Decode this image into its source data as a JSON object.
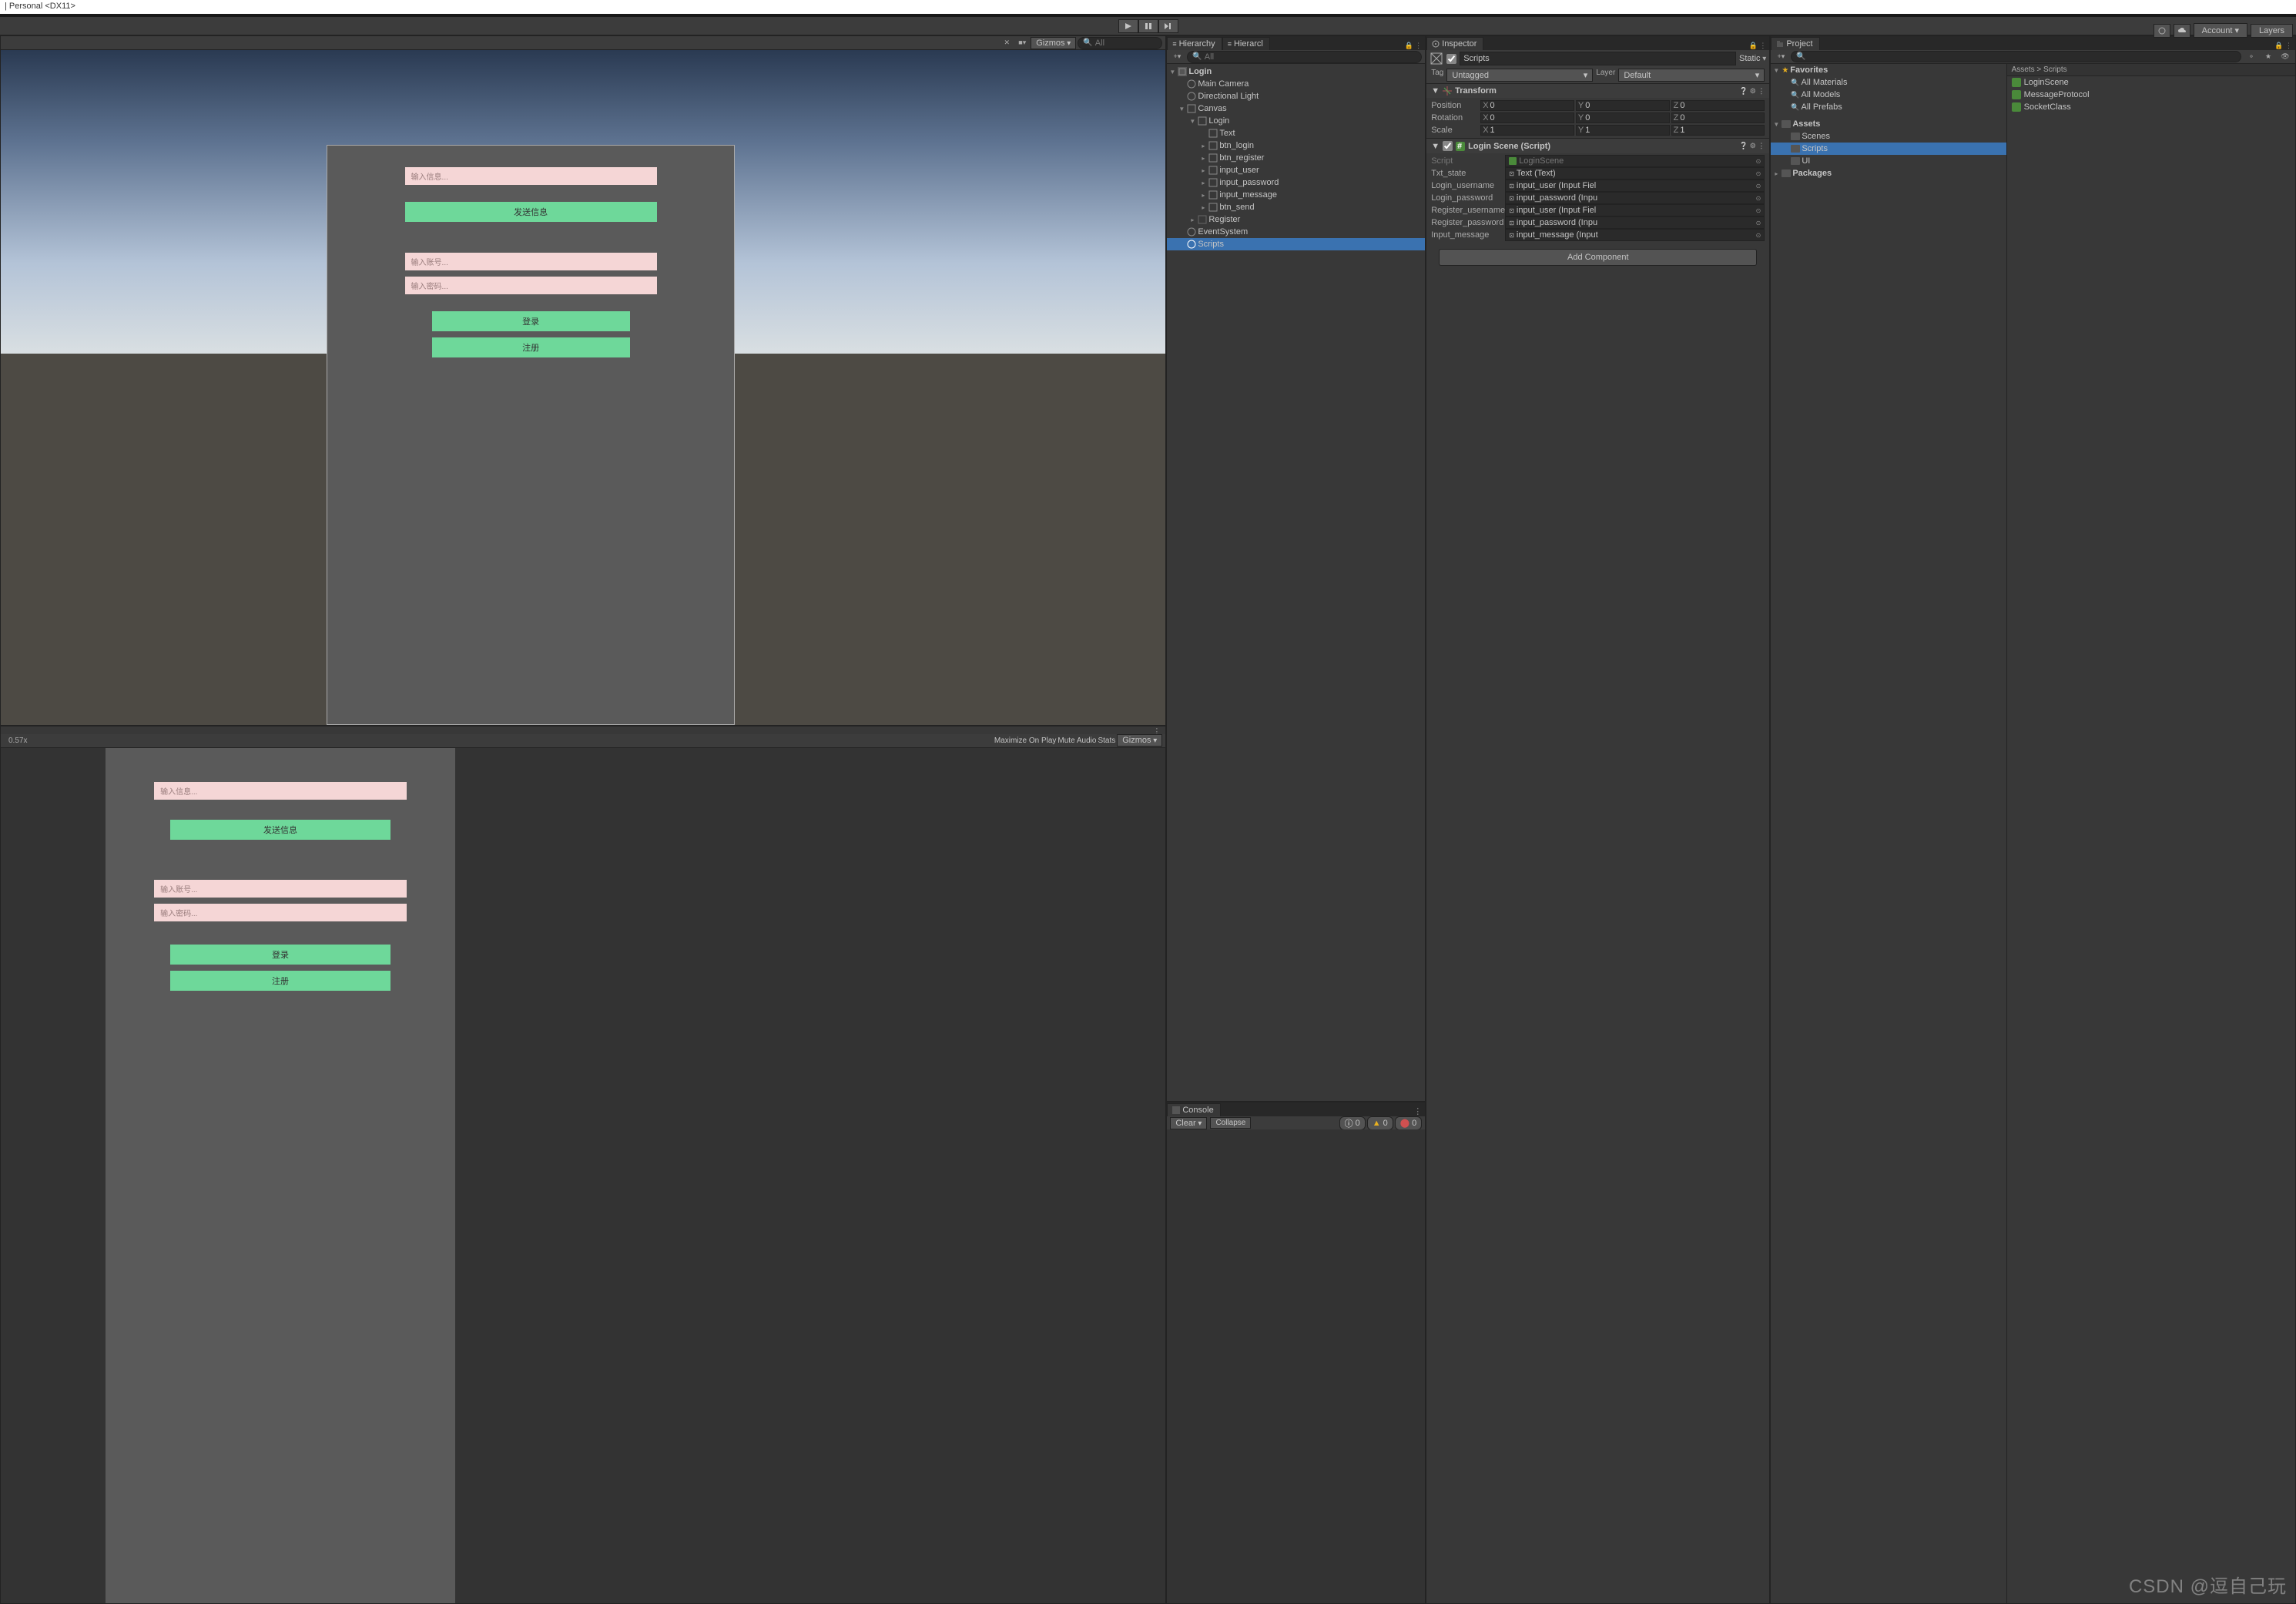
{
  "titlebar": "| Personal <DX11>",
  "topbar": {
    "account": "Account",
    "layers": "Layers"
  },
  "scene_toolbar": {
    "gizmos": "Gizmos",
    "search_placeholder": "All"
  },
  "game_toolbar": {
    "scale": "0.57x",
    "maximize": "Maximize On Play",
    "mute": "Mute Audio",
    "stats": "Stats",
    "gizmos": "Gizmos"
  },
  "game_ui": {
    "input_info": "输入信息...",
    "btn_send": "发送信息",
    "input_user": "输入账号...",
    "input_pwd": "输入密码...",
    "btn_login": "登录",
    "btn_register": "注册"
  },
  "hierarchy": {
    "tab": "Hierarchy",
    "tab2": "Hierarcl",
    "search_placeholder": "All",
    "root": "Login",
    "items": [
      "Main Camera",
      "Directional Light",
      "Canvas",
      "Login",
      "Text",
      "btn_login",
      "btn_register",
      "input_user",
      "input_password",
      "input_message",
      "btn_send",
      "Register",
      "EventSystem",
      "Scripts"
    ]
  },
  "console": {
    "tab": "Console",
    "clear": "Clear",
    "collapse": "Collapse",
    "info": "0",
    "warn": "0",
    "err": "0"
  },
  "inspector": {
    "tab": "Inspector",
    "name": "Scripts",
    "static": "Static",
    "tag_label": "Tag",
    "tag": "Untagged",
    "layer_label": "Layer",
    "layer": "Default",
    "transform": {
      "title": "Transform",
      "position": "Position",
      "rotation": "Rotation",
      "scale": "Scale",
      "px": "0",
      "py": "0",
      "pz": "0",
      "rx": "0",
      "ry": "0",
      "rz": "0",
      "sx": "1",
      "sy": "1",
      "sz": "1"
    },
    "script_comp": {
      "title": "Login Scene (Script)",
      "rows": [
        {
          "label": "Script",
          "value": "LoginScene",
          "icon": "cs"
        },
        {
          "label": "Txt_state",
          "value": "Text (Text)",
          "icon": "obj"
        },
        {
          "label": "Login_username",
          "value": "input_user (Input Fiel",
          "icon": "obj"
        },
        {
          "label": "Login_password",
          "value": "input_password (Inpu",
          "icon": "obj"
        },
        {
          "label": "Register_username",
          "value": "input_user (Input Fiel",
          "icon": "obj"
        },
        {
          "label": "Register_password",
          "value": "input_password (Inpu",
          "icon": "obj"
        },
        {
          "label": "Input_message",
          "value": "input_message (Input",
          "icon": "obj"
        }
      ]
    },
    "add_component": "Add Component"
  },
  "project": {
    "tab": "Project",
    "favorites": "Favorites",
    "fav_items": [
      "All Materials",
      "All Models",
      "All Prefabs"
    ],
    "assets": "Assets",
    "asset_items": [
      "Scenes",
      "Scripts",
      "UI"
    ],
    "packages": "Packages",
    "breadcrumb": "Assets > Scripts",
    "files": [
      "LoginScene",
      "MessageProtocol",
      "SocketClass"
    ]
  },
  "watermark": "CSDN @逗自己玩"
}
